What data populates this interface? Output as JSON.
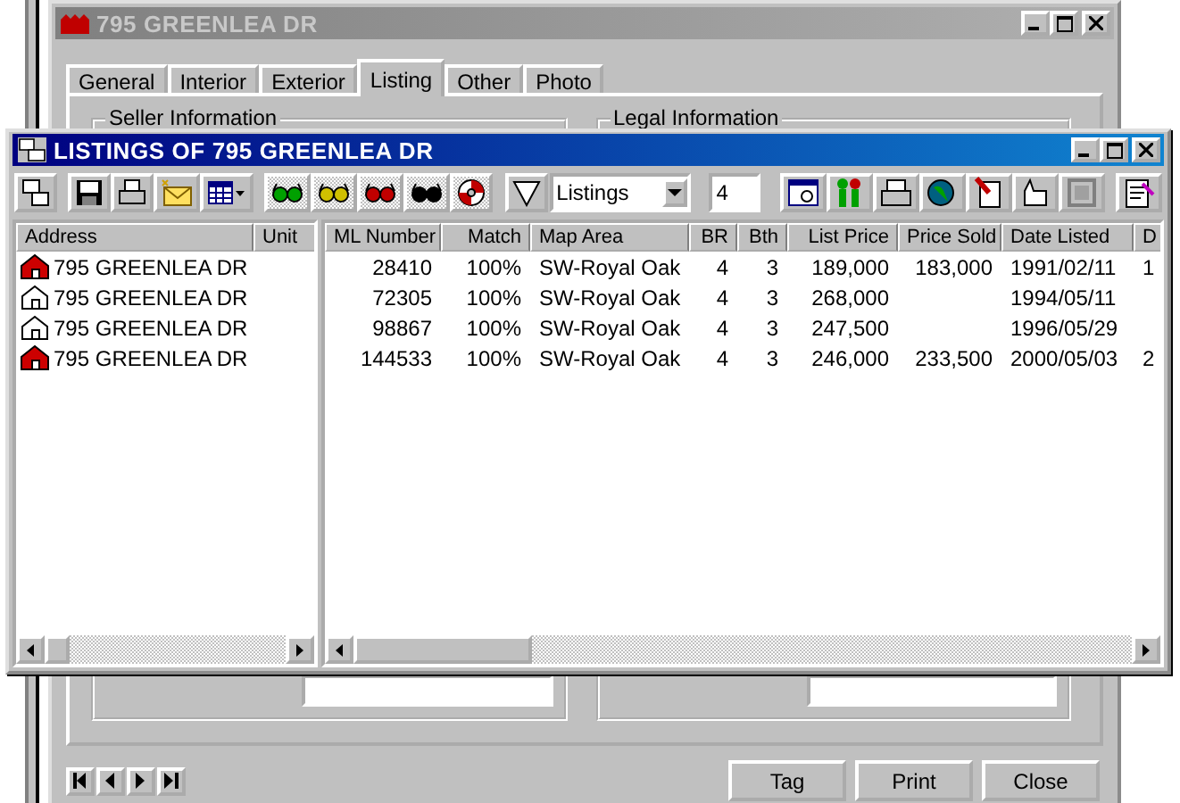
{
  "back_window": {
    "title": "795 GREENLEA DR",
    "tabs": [
      {
        "label": "General",
        "selected": false
      },
      {
        "label": "Interior",
        "selected": false
      },
      {
        "label": "Exterior",
        "selected": false
      },
      {
        "label": "Listing",
        "selected": true
      },
      {
        "label": "Other",
        "selected": false
      },
      {
        "label": "Photo",
        "selected": false
      }
    ],
    "groups": [
      {
        "title": "Seller Information"
      },
      {
        "title": "Legal Information"
      }
    ],
    "buttons": [
      "Tag",
      "Print",
      "Close"
    ]
  },
  "listings_window": {
    "title": "LISTINGS OF 795 GREENLEA DR",
    "view_select": {
      "value": "Listings"
    },
    "count_field": {
      "value": "4"
    },
    "left_columns": [
      "Address",
      "Unit"
    ],
    "right_columns": [
      "ML Number",
      "Match",
      "Map Area",
      "BR",
      "Bth",
      "List Price",
      "Price Sold",
      "Date Listed",
      "D"
    ],
    "rows": [
      {
        "kind": "filled",
        "address": "795 GREENLEA DR",
        "ml_number": "28410",
        "match": "100%",
        "map_area": "SW-Royal Oak",
        "br": "4",
        "bth": "3",
        "list_price": "189,000",
        "price_sold": "183,000",
        "date_listed": "1991/02/11",
        "column_9": "1"
      },
      {
        "kind": "outline",
        "address": "795 GREENLEA DR",
        "ml_number": "72305",
        "match": "100%",
        "map_area": "SW-Royal Oak",
        "br": "4",
        "bth": "3",
        "list_price": "268,000",
        "date_listed": "1994/05/11"
      },
      {
        "kind": "outline",
        "address": "795 GREENLEA DR",
        "ml_number": "98867",
        "match": "100%",
        "map_area": "SW-Royal Oak",
        "br": "4",
        "bth": "3",
        "list_price": "247,500",
        "date_listed": "1996/05/29"
      },
      {
        "kind": "filled",
        "address": "795 GREENLEA DR",
        "ml_number": "144533",
        "match": "100%",
        "map_area": "SW-Royal Oak",
        "br": "4",
        "bth": "3",
        "list_price": "246,000",
        "price_sold": "233,500",
        "date_listed": "2000/05/03",
        "column_9": "2"
      }
    ]
  }
}
